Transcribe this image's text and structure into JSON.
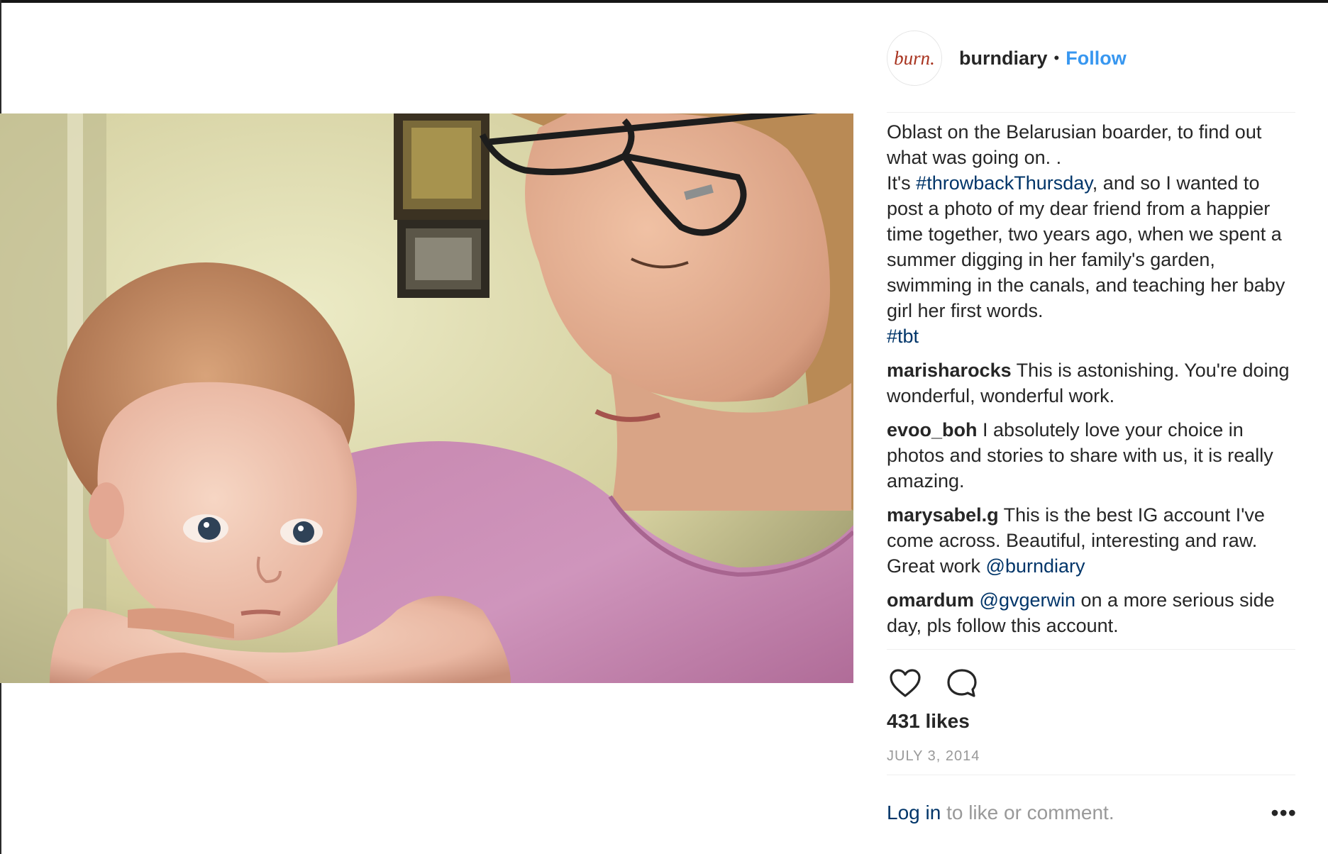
{
  "post": {
    "username": "burndiary",
    "avatar_text": "burn.",
    "follow_label": "Follow",
    "separator": "•",
    "caption_lines": [
      "Oblast on the Belarusian boarder, to find out",
      "what was going on. ."
    ],
    "caption2_prefix": "It's ",
    "caption2_tag": "#throwbackThursday",
    "caption2_text": ", and so I wanted to post a photo of my dear friend from a happier time together, two years ago, when we spent a summer digging in her family's garden, swimming in the canals, and teaching her baby girl her first words.",
    "caption2_tag2": "#tbt",
    "comments": [
      {
        "user": "marisharocks",
        "text": "This is astonishing. You're doing wonderful, wonderful work."
      },
      {
        "user": "evoo_boh",
        "text": "I absolutely love your choice in photos and stories to share with us, it is really amazing."
      },
      {
        "user": "marysabel.g",
        "text": "This is the best IG account I've come across. Beautiful, interesting and raw. Great work ",
        "mention": "@burndiary"
      },
      {
        "user": "omardum",
        "mention": "@gvgerwin",
        "text": " on a more serious side day, pls follow this account."
      }
    ],
    "likes": "431 likes",
    "date": "JULY 3, 2014",
    "login_link": "Log in",
    "login_rest": " to like or comment.",
    "more_label": "•••"
  },
  "icons": {
    "like": "heart-outline-icon",
    "comment": "speech-bubble-icon",
    "more": "three-dots-icon"
  },
  "colors": {
    "link_blue": "#3897f0",
    "hashtag_navy": "#003569",
    "muted_gray": "#999999",
    "text": "#262626",
    "avatar_red": "#a8331f"
  }
}
